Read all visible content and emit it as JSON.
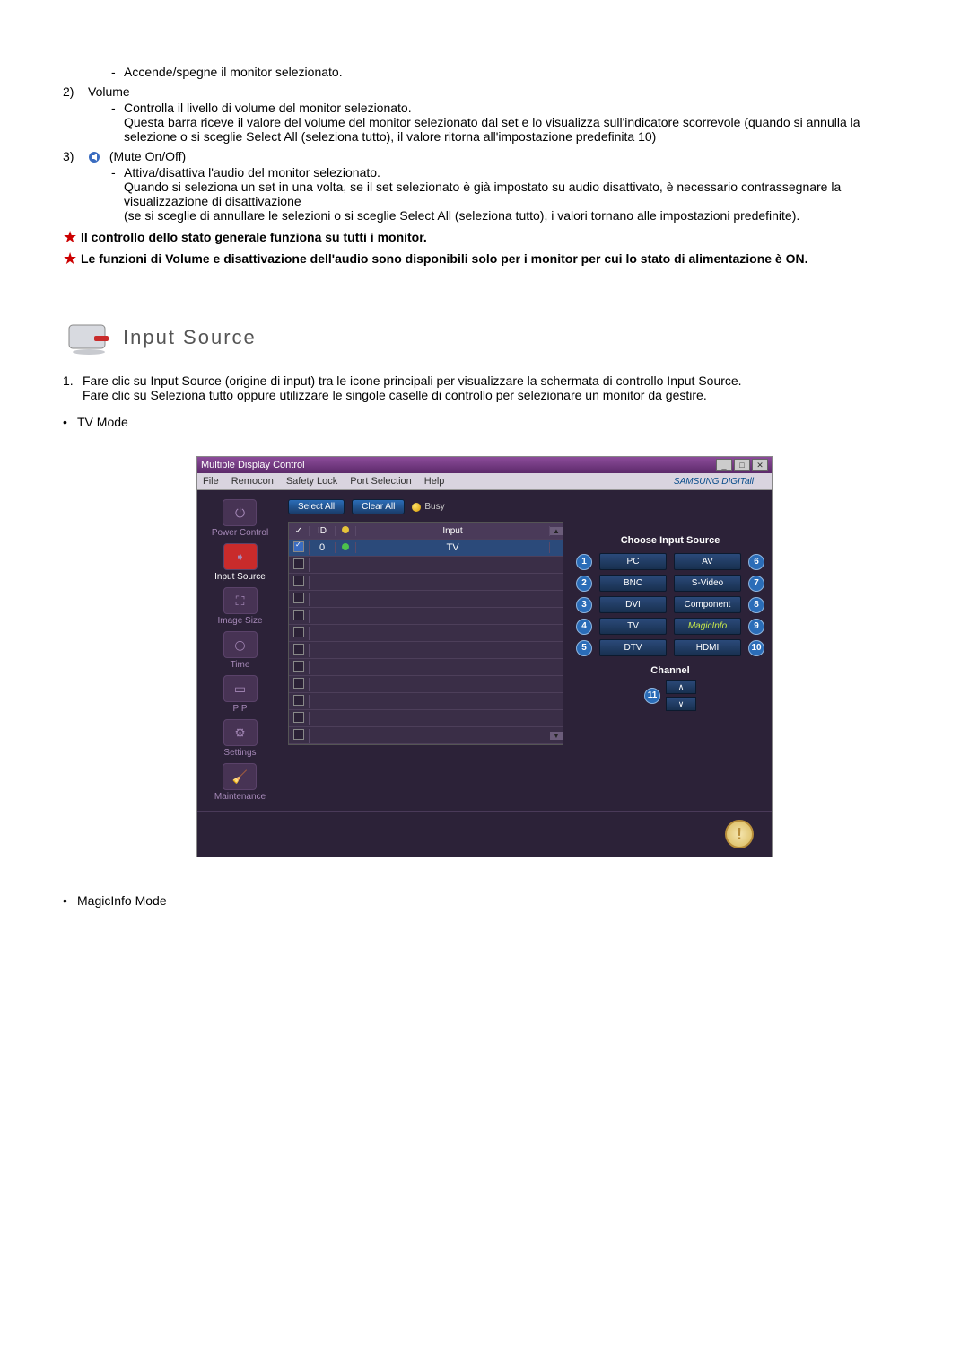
{
  "list": {
    "item1_sub1": "Accende/spegne il monitor selezionato.",
    "item2_num": "2)",
    "item2_label": "Volume",
    "item2_sub1": "Controlla il livello di volume del monitor selezionato.",
    "item2_sub1b": "Questa barra riceve il valore del volume del monitor selezionato dal set e lo visualizza sull'indicatore scorrevole (quando si annulla la selezione o si sceglie Select All (seleziona tutto), il valore ritorna all'impostazione predefinita 10)",
    "item3_num": "3)",
    "item3_label": "(Mute On/Off)",
    "item3_sub1": "Attiva/disattiva l'audio del monitor selezionato.",
    "item3_sub1b": "Quando si seleziona un set in una volta, se il set selezionato è già impostato su audio disattivato, è necessario contrassegnare la visualizzazione di disattivazione",
    "item3_sub1c": "(se si sceglie di annullare le selezioni o si sceglie Select All (seleziona tutto), i valori tornano alle impostazioni predefinite)."
  },
  "stars": {
    "s1": "Il controllo dello stato generale funziona su tutti i monitor.",
    "s2": "Le funzioni di Volume e disattivazione dell'audio sono disponibili solo per i monitor per cui lo stato di alimentazione è ON."
  },
  "section": {
    "title": "Input Source"
  },
  "para": {
    "n1_num": "1.",
    "n1_line1": "Fare clic su Input Source (origine di input) tra le icone principali per visualizzare la schermata di controllo Input Source.",
    "n1_line2": "Fare clic su Seleziona tutto oppure utilizzare le singole caselle di controllo per selezionare un monitor da gestire."
  },
  "bullets": {
    "b1": "TV Mode",
    "b2": "MagicInfo Mode"
  },
  "app": {
    "title": "Multiple Display Control",
    "menu": {
      "file": "File",
      "remocon": "Remocon",
      "safety": "Safety Lock",
      "port": "Port Selection",
      "help": "Help"
    },
    "brand": "SAMSUNG DIGITall",
    "sidebar": {
      "power": "Power Control",
      "input": "Input Source",
      "image": "Image Size",
      "time": "Time",
      "pip": "PIP",
      "settings": "Settings",
      "maint": "Maintenance"
    },
    "buttons": {
      "select_all": "Select All",
      "clear_all": "Clear All",
      "busy": "Busy"
    },
    "grid": {
      "hdr_chk": "✓",
      "hdr_id": "ID",
      "hdr_input": "Input",
      "row0_id": "0",
      "row0_input": "TV"
    },
    "panel": {
      "title": "Choose Input Source",
      "pc": "PC",
      "av": "AV",
      "bnc": "BNC",
      "svideo": "S-Video",
      "dvi": "DVI",
      "component": "Component",
      "tv": "TV",
      "magic": "MagicInfo",
      "dtv": "DTV",
      "hdmi": "HDMI",
      "n1": "1",
      "n2": "2",
      "n3": "3",
      "n4": "4",
      "n5": "5",
      "n6": "6",
      "n7": "7",
      "n8": "8",
      "n9": "9",
      "n10": "10",
      "n11": "11",
      "channel": "Channel"
    }
  }
}
